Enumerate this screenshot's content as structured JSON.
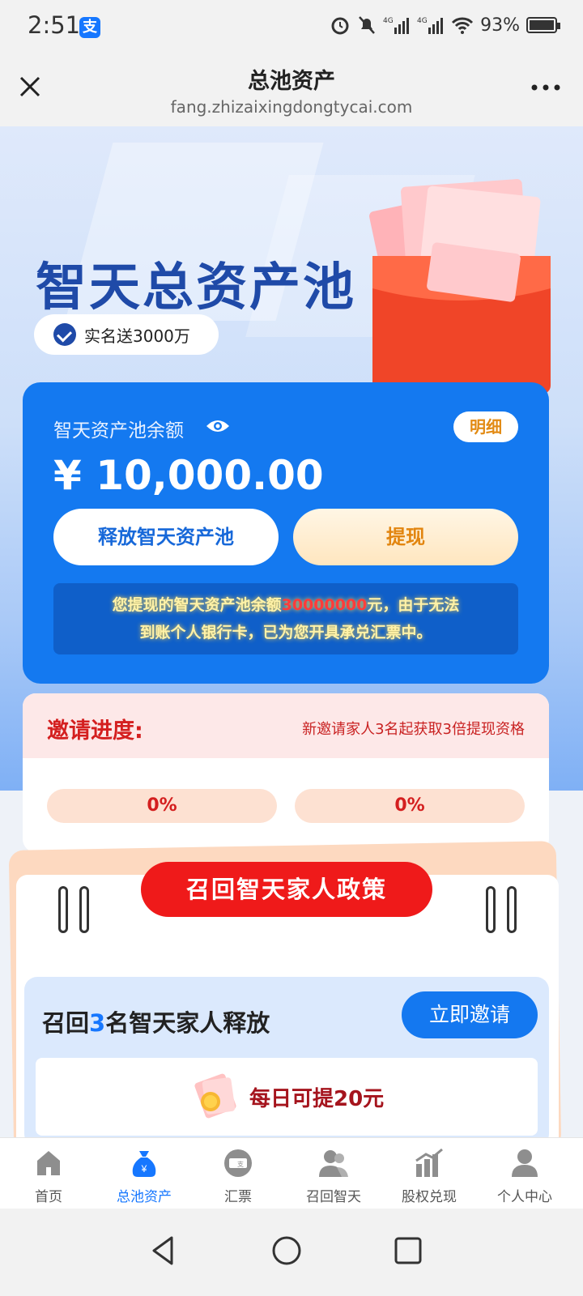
{
  "status_bar": {
    "time": "2:51",
    "alipay_badge": "支",
    "battery_percent": "93%"
  },
  "navbar": {
    "title": "总池资产",
    "url": "fang.zhizaixingdongtycai.com"
  },
  "hero": {
    "title": "智天总资产池",
    "badge": "实名送3000万"
  },
  "balance_card": {
    "label": "智天资产池余额",
    "detail_button": "明细",
    "amount": "¥ 10,000.00",
    "release_button": "释放智天资产池",
    "withdraw_button": "提现",
    "notice_prefix": "您提现的智天资产池余额",
    "notice_amount": "30000000",
    "notice_suffix": "元，由于无法",
    "notice_line2": "到账个人银行卡，已为您开具承兑汇票中。"
  },
  "invite_progress": {
    "title": "邀请进度:",
    "tip": "新邀请家人3名起获取3倍提现资格",
    "progress": [
      "0%",
      "0%"
    ]
  },
  "policy": {
    "banner": "召回智天家人政策",
    "recall_prefix": "召回",
    "recall_count": "3",
    "recall_suffix": "名智天家人释放",
    "invite_button": "立即邀请",
    "daily_text": "每日可提20元"
  },
  "tabbar": {
    "items": [
      {
        "label": "首页",
        "icon": "home-icon"
      },
      {
        "label": "总池资产",
        "icon": "money-bag-icon",
        "active": true
      },
      {
        "label": "汇票",
        "icon": "ticket-icon"
      },
      {
        "label": "召回智天",
        "icon": "users-icon"
      },
      {
        "label": "股权兑现",
        "icon": "chart-icon"
      },
      {
        "label": "个人中心",
        "icon": "person-icon"
      }
    ]
  },
  "colors": {
    "primary": "#1479f0",
    "accent_red": "#ef1a1a",
    "gold": "#e2850f"
  }
}
